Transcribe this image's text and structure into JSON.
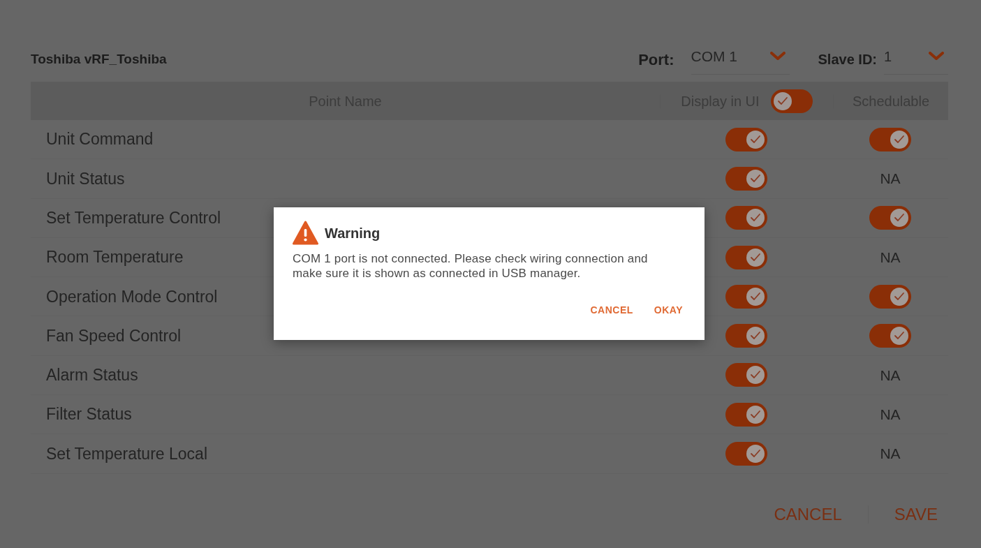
{
  "device": {
    "title": "Toshiba vRF_Toshiba"
  },
  "port": {
    "label": "Port:",
    "value": "COM 1"
  },
  "slave_id": {
    "label": "Slave ID:",
    "value": "1"
  },
  "table": {
    "columns": [
      {
        "label": "Point Name"
      },
      {
        "label": "Display in UI",
        "toggle": {
          "on": false
        }
      },
      {
        "label": "Schedulable"
      }
    ],
    "rows": [
      {
        "name": "Unit Command",
        "display_in_ui": {
          "on": true
        },
        "schedulable": {
          "kind": "toggle",
          "on": true
        }
      },
      {
        "name": "Unit Status",
        "display_in_ui": {
          "on": true
        },
        "schedulable": {
          "kind": "text",
          "text": "NA"
        }
      },
      {
        "name": "Set Temperature Control",
        "display_in_ui": {
          "on": true
        },
        "schedulable": {
          "kind": "toggle",
          "on": true
        }
      },
      {
        "name": "Room Temperature",
        "display_in_ui": {
          "on": true
        },
        "schedulable": {
          "kind": "text",
          "text": "NA"
        }
      },
      {
        "name": "Operation Mode Control",
        "display_in_ui": {
          "on": true
        },
        "schedulable": {
          "kind": "toggle",
          "on": true
        }
      },
      {
        "name": "Fan Speed Control",
        "display_in_ui": {
          "on": true
        },
        "schedulable": {
          "kind": "toggle",
          "on": true
        }
      },
      {
        "name": "Alarm Status",
        "display_in_ui": {
          "on": true
        },
        "schedulable": {
          "kind": "text",
          "text": "NA"
        }
      },
      {
        "name": "Filter Status",
        "display_in_ui": {
          "on": true
        },
        "schedulable": {
          "kind": "text",
          "text": "NA"
        }
      },
      {
        "name": "Set Temperature Local",
        "display_in_ui": {
          "on": true
        },
        "schedulable": {
          "kind": "text",
          "text": "NA"
        }
      }
    ]
  },
  "footer_buttons": [
    "CANCEL",
    "SAVE"
  ],
  "dialog": {
    "title": "Warning",
    "message": "COM 1 port is not connected. Please check wiring connection and make sure it is shown as connected in USB manager.",
    "buttons": [
      "CANCEL",
      "OKAY"
    ]
  }
}
